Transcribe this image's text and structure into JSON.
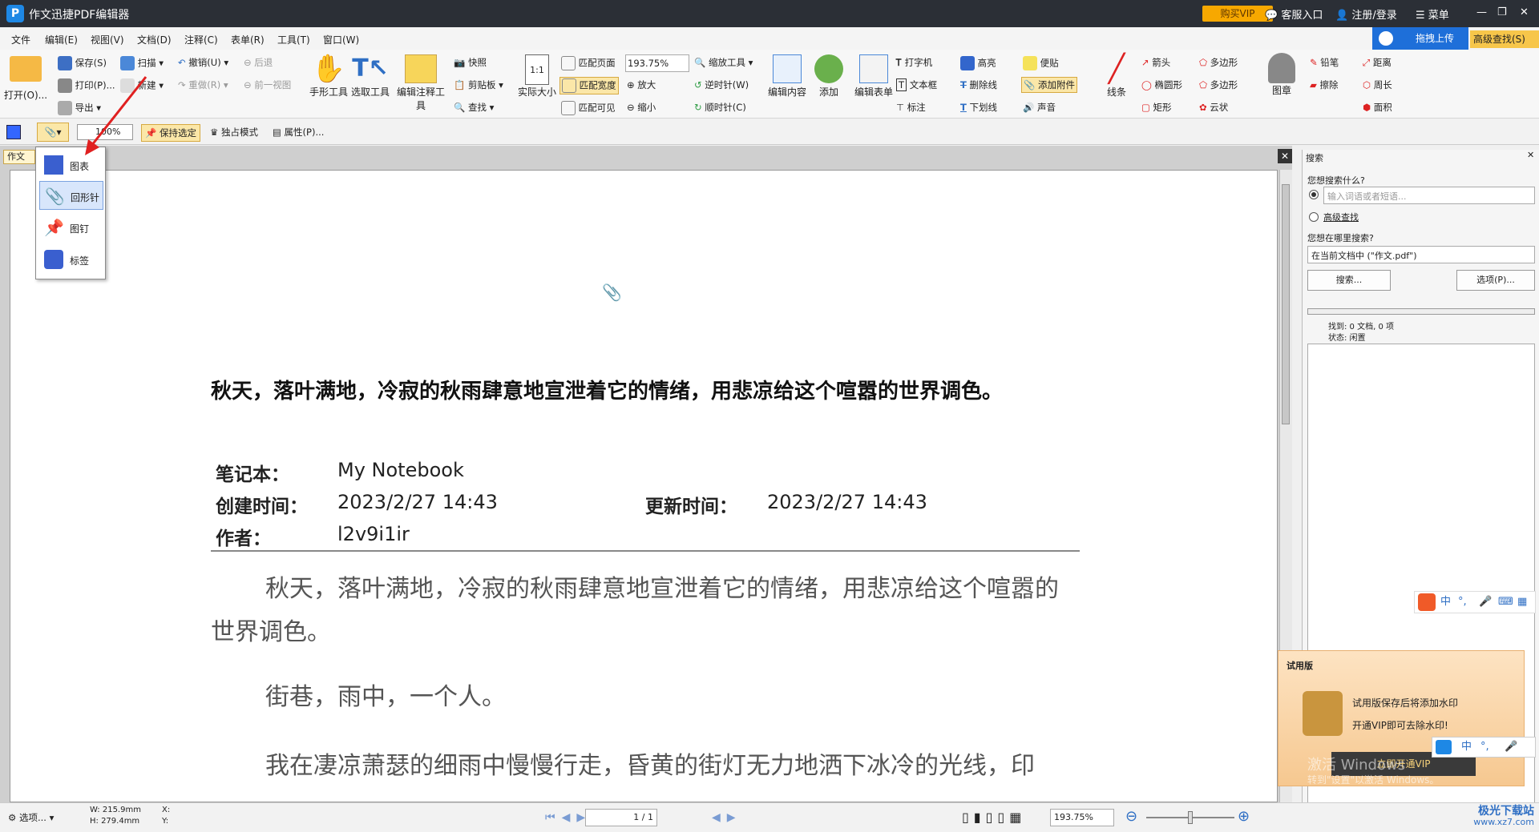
{
  "app": {
    "title": "作文迅捷PDF编辑器",
    "logo": "P",
    "vip": "购买VIP",
    "service": "客服入口",
    "login": "注册/登录",
    "menu": "菜单"
  },
  "menu": [
    "文件",
    "编辑(E)",
    "视图(V)",
    "文档(D)",
    "注释(C)",
    "表单(R)",
    "工具(T)",
    "窗口(W)"
  ],
  "upload": {
    "label": "拖拽上传",
    "advanced": "高级查找(S)"
  },
  "ribbon": {
    "open": "打开(O)...",
    "save": "保存(S)",
    "print": "打印(P)...",
    "export": "导出",
    "scan": "扫描",
    "new": "新建",
    "undo": "撤销(U)",
    "redo": "重做(R)",
    "back": "后退",
    "fwd": "前一视图",
    "hand": "手形工具",
    "select": "选取工具",
    "edit_annot": "编辑注释工具",
    "snapshot": "快照",
    "clipboard": "剪贴板",
    "find": "查找",
    "actual": "实际大小",
    "fit_page": "匹配页面",
    "fit_width": "匹配宽度",
    "fit_visible": "匹配可见",
    "zoom_value": "193.75%",
    "zoom_in": "放大",
    "zoom_out": "缩小",
    "zoom_tool": "缩放工具",
    "ccw": "逆时针(W)",
    "cw": "顺时针(C)",
    "edit_content": "编辑内容",
    "add": "添加",
    "edit_form": "编辑表单",
    "typewriter": "打字机",
    "textbox": "文本框",
    "callout": "标注",
    "highlight": "高亮",
    "strike": "删除线",
    "underline": "下划线",
    "note": "便贴",
    "attach": "添加附件",
    "sound": "声音",
    "line": "线条",
    "arrow": "箭头",
    "ellipse": "椭圆形",
    "rect": "矩形",
    "polygon": "多边形",
    "polyline": "多边形",
    "cloud": "云状",
    "stamp": "图章",
    "pencil": "铅笔",
    "eraser": "擦除",
    "distance": "距离",
    "perimeter": "周长",
    "area": "面积"
  },
  "toolbar2": {
    "zoom": "100%",
    "keep": "保持选定",
    "exclusive": "独占模式",
    "props": "属性(P)..."
  },
  "popup": [
    "图表",
    "回形针",
    "图钉",
    "标签"
  ],
  "doc": {
    "tab": "作文",
    "title": "秋天，落叶满地，冷寂的秋雨肆意地宣泄着它的情绪，用悲凉给这个喧嚣的世界调色。",
    "notebook_label": "笔记本：",
    "notebook": "My Notebook",
    "created_label": "创建时间：",
    "created": "2023/2/27 14:43",
    "updated_label": "更新时间：",
    "updated": "2023/2/27 14:43",
    "author_label": "作者：",
    "author": "l2v9i1ir",
    "p1": "秋天，落叶满地，冷寂的秋雨肆意地宣泄着它的情绪，用悲凉给这个喧嚣的世界调色。",
    "p2": "街巷，雨中，一个人。",
    "p3": "我在凄凉萧瑟的细雨中慢慢行走，昏黄的街灯无力地洒下冰冷的光线，印"
  },
  "search": {
    "title": "搜索",
    "q": "您想搜索什么?",
    "placeholder": "输入词语或者短语...",
    "adv": "高级查找",
    "where": "您想在哪里搜索?",
    "scope": "在当前文档中 (\"作文.pdf\")",
    "btn": "搜索...",
    "opt": "选项(P)...",
    "found": "找到: 0 文档, 0 项",
    "state": "状态: 闲置"
  },
  "trial": {
    "title": "试用版",
    "l1": "试用版保存后将添加水印",
    "l2": "开通VIP即可去除水印!",
    "btn": "立即开通VIP",
    "wm1": "激活 Windows",
    "wm2": "转到\"设置\"以激活 Windows。"
  },
  "status": {
    "opt": "选项...",
    "w": "W: 215.9mm",
    "h": "H: 279.4mm",
    "x": "X:",
    "y": "Y:",
    "page": "1 / 1",
    "zoom": "193.75%"
  },
  "ime": [
    "中",
    "°,",
    "中",
    "°,"
  ],
  "watermark": "极光下载站",
  "wm_url": "www.xz7.com"
}
